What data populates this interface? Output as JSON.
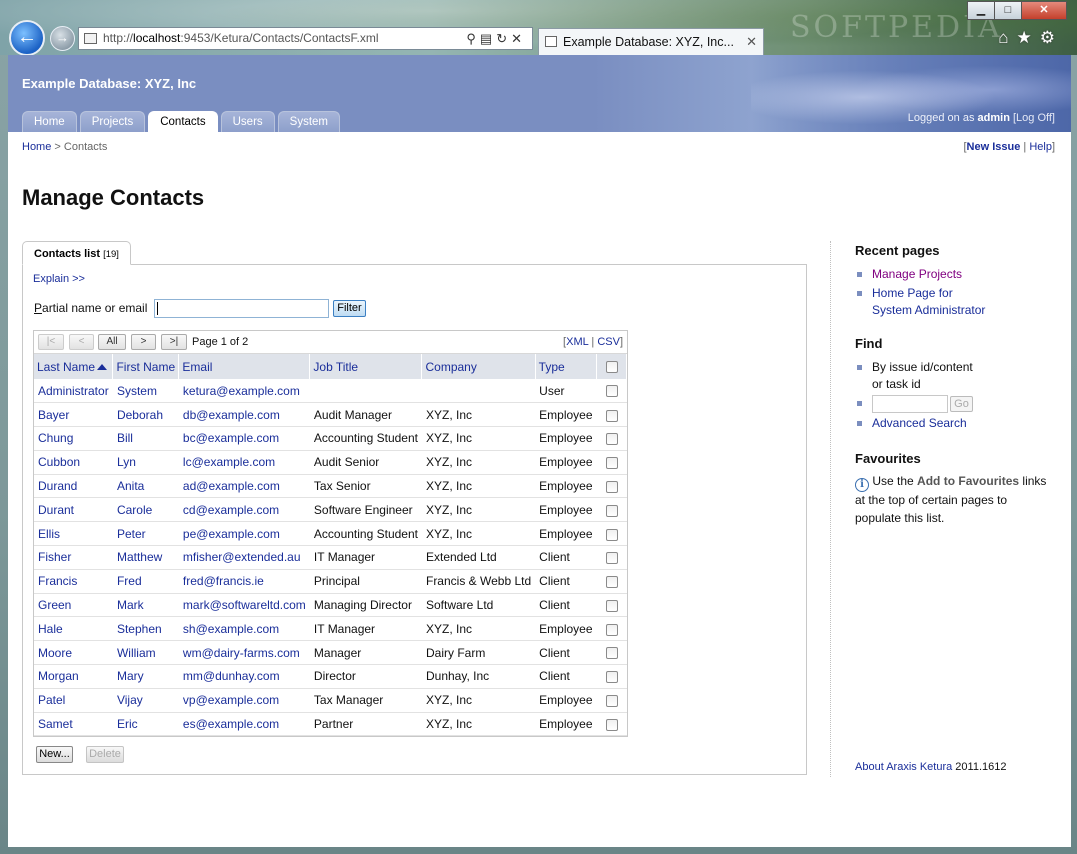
{
  "browser": {
    "url_prefix": "http://",
    "url_host": "localhost",
    "url_rest": ":9453/Ketura/Contacts/ContactsF.xml",
    "tab_title": "Example Database: XYZ, Inc...",
    "tab_close": "✕",
    "watermark": "SOFTPEDIA",
    "window_buttons": {
      "minimize": "▁",
      "maximize": "□",
      "close": "✕"
    },
    "icons": [
      "home-icon",
      "star-icon",
      "gear-icon"
    ]
  },
  "site": {
    "title": "Example Database: XYZ, Inc",
    "tabs": [
      "Home",
      "Projects",
      "Contacts",
      "Users",
      "System"
    ],
    "active_tab": "Contacts",
    "logged_prefix": "Logged on as",
    "logged_user": "admin",
    "logoff": "[Log Off]"
  },
  "breadcrumb": {
    "home": "Home",
    "sep": ">",
    "current": "Contacts"
  },
  "toplinks": {
    "new_issue": "New Issue",
    "help": "Help"
  },
  "page": {
    "title": "Manage Contacts"
  },
  "contacts": {
    "tab_label": "Contacts list",
    "tab_count": "[19]",
    "explain": "Explain >>",
    "filter_label_first": "P",
    "filter_label_rest": "artial name or email",
    "filter_value": "",
    "filter_button": "Filter",
    "pager": {
      "first": "|<",
      "prev": "<",
      "all": "All",
      "next": ">",
      "last": ">|",
      "info": "Page 1 of 2"
    },
    "export": {
      "xml": "XML",
      "csv": "CSV"
    },
    "columns": [
      "Last Name",
      "First Name",
      "Email",
      "Job Title",
      "Company",
      "Type"
    ],
    "sorted_column": "Last Name",
    "rows": [
      [
        "Administrator",
        "System",
        "ketura@example.com",
        "",
        "",
        "User"
      ],
      [
        "Bayer",
        "Deborah",
        "db@example.com",
        "Audit Manager",
        "XYZ, Inc",
        "Employee"
      ],
      [
        "Chung",
        "Bill",
        "bc@example.com",
        "Accounting Student",
        "XYZ, Inc",
        "Employee"
      ],
      [
        "Cubbon",
        "Lyn",
        "lc@example.com",
        "Audit Senior",
        "XYZ, Inc",
        "Employee"
      ],
      [
        "Durand",
        "Anita",
        "ad@example.com",
        "Tax Senior",
        "XYZ, Inc",
        "Employee"
      ],
      [
        "Durant",
        "Carole",
        "cd@example.com",
        "Software Engineer",
        "XYZ, Inc",
        "Employee"
      ],
      [
        "Ellis",
        "Peter",
        "pe@example.com",
        "Accounting Student",
        "XYZ, Inc",
        "Employee"
      ],
      [
        "Fisher",
        "Matthew",
        "mfisher@extended.au",
        "IT Manager",
        "Extended Ltd",
        "Client"
      ],
      [
        "Francis",
        "Fred",
        "fred@francis.ie",
        "Principal",
        "Francis & Webb Ltd",
        "Client"
      ],
      [
        "Green",
        "Mark",
        "mark@softwareltd.com",
        "Managing Director",
        "Software Ltd",
        "Client"
      ],
      [
        "Hale",
        "Stephen",
        "sh@example.com",
        "IT Manager",
        "XYZ, Inc",
        "Employee"
      ],
      [
        "Moore",
        "William",
        "wm@dairy-farms.com",
        "Manager",
        "Dairy Farm",
        "Client"
      ],
      [
        "Morgan",
        "Mary",
        "mm@dunhay.com",
        "Director",
        "Dunhay, Inc",
        "Client"
      ],
      [
        "Patel",
        "Vijay",
        "vp@example.com",
        "Tax Manager",
        "XYZ, Inc",
        "Employee"
      ],
      [
        "Samet",
        "Eric",
        "es@example.com",
        "Partner",
        "XYZ, Inc",
        "Employee"
      ]
    ],
    "new_button": "New...",
    "delete_button": "Delete"
  },
  "sidebar": {
    "recent_title": "Recent pages",
    "recent": [
      "Manage Projects",
      "Home Page for System Administrator"
    ],
    "find_title": "Find",
    "find_label": "By issue id/content or task id",
    "go_button": "Go",
    "advanced": "Advanced Search",
    "fav_title": "Favourites",
    "fav_pre": "Use the",
    "fav_bold": "Add to Favourites",
    "fav_post": "links at the top of certain pages to populate this list."
  },
  "footer": {
    "about_link": "About Araxis Ketura",
    "version": "2011.1612"
  },
  "colors": {
    "banner": "#7a8ec1",
    "link": "#1a2e9a",
    "header_bg": "#dfe3ea"
  }
}
